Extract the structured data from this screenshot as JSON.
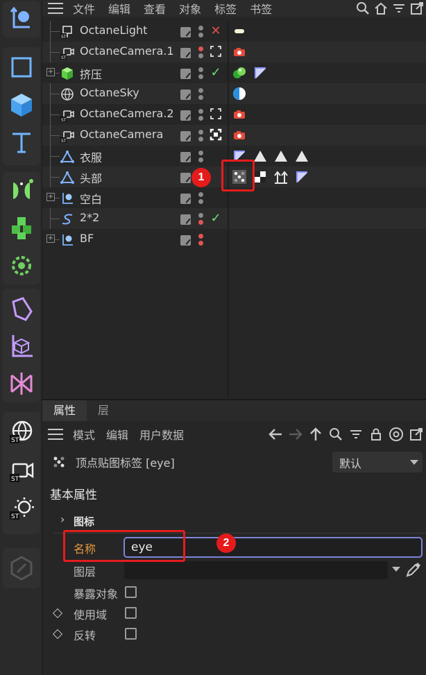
{
  "object_manager": {
    "menu": [
      "文件",
      "编辑",
      "查看",
      "对象",
      "标签",
      "书签"
    ],
    "toolbar_icons": [
      "search-icon",
      "home-icon",
      "filter-icon",
      "new-window-icon"
    ],
    "objects": [
      {
        "name": "OctaneLight",
        "icon": "octane-light-icon",
        "expand": false,
        "dot_top": "#8a8a8a",
        "dot_bottom": "#8a8a8a",
        "state": "x",
        "tags": [
          "light-tag"
        ]
      },
      {
        "name": "OctaneCamera.1",
        "icon": "octane-camera-icon",
        "expand": false,
        "dot_top": "#e25555",
        "dot_bottom": "#8a8a8a",
        "state": "target",
        "tags": [
          "camera-tag"
        ]
      },
      {
        "name": "挤压",
        "icon": "extrude-icon",
        "expand": true,
        "dot_top": "#8a8a8a",
        "dot_bottom": "#8a8a8a",
        "state": "check",
        "tags": [
          "material-ball-tag",
          "selection-tag"
        ]
      },
      {
        "name": "OctaneSky",
        "icon": "octane-sky-icon",
        "expand": false,
        "dot_top": "#8a8a8a",
        "dot_bottom": "#8a8a8a",
        "state": "",
        "tags": [
          "environment-tag"
        ]
      },
      {
        "name": "OctaneCamera.2",
        "icon": "octane-camera-icon",
        "expand": false,
        "dot_top": "#8a8a8a",
        "dot_bottom": "#8a8a8a",
        "state": "target",
        "tags": [
          "camera-tag"
        ]
      },
      {
        "name": "OctaneCamera",
        "icon": "octane-camera-icon",
        "expand": false,
        "dot_top": "#8a8a8a",
        "dot_bottom": "#8a8a8a",
        "state": "target-active",
        "tags": [
          "camera-tag"
        ]
      },
      {
        "name": "衣服",
        "icon": "polygon-object-icon",
        "expand": false,
        "dot_top": "#8a8a8a",
        "dot_bottom": "#8a8a8a",
        "state": "",
        "tags": [
          "selection-tag",
          "triangle-tag",
          "triangle-tag",
          "triangle-tag"
        ]
      },
      {
        "name": "头部",
        "icon": "polygon-object-icon",
        "expand": false,
        "dot_top": "#8a8a8a",
        "dot_bottom": "#8a8a8a",
        "state": "",
        "tags": [
          "vertex-map-tag",
          "checker-tag",
          "arrows-tag",
          "selection-tag"
        ]
      },
      {
        "name": "空白",
        "icon": "null-object-icon",
        "expand": true,
        "dot_top": "#8a8a8a",
        "dot_bottom": "#8a8a8a",
        "state": "",
        "tags": []
      },
      {
        "name": "2*2",
        "icon": "spline-icon",
        "expand": false,
        "dot_top": "#8a8a8a",
        "dot_bottom": "#e25555",
        "state": "check",
        "tags": []
      },
      {
        "name": "BF",
        "icon": "null-object-icon",
        "expand": true,
        "dot_top": "#e25555",
        "dot_bottom": "#e25555",
        "state": "",
        "tags": []
      }
    ]
  },
  "annotations": {
    "badge_1": "1",
    "badge_2": "2"
  },
  "attribute_manager": {
    "tabs": [
      "属性",
      "层"
    ],
    "menu": [
      "模式",
      "编辑",
      "用户数据"
    ],
    "nav_icons": [
      "back-arrow-icon",
      "forward-arrow-icon",
      "up-arrow-icon",
      "search-icon",
      "filter-icon",
      "lock-icon",
      "target-icon",
      "new-window-icon"
    ],
    "object_title": "顶点贴图标签 [eye]",
    "preset": "默认",
    "section_title": "基本属性",
    "group_label": "图标",
    "fields": {
      "name_label": "名称",
      "name_value": "eye",
      "layer_label": "图层",
      "expose_label": "暴露对象",
      "use_domain_label": "使用域",
      "invert_label": "反转"
    }
  },
  "colors": {
    "accent_red": "#e51b1b",
    "name_label_orange": "#e69a3c",
    "input_focus": "#7f84d8"
  }
}
